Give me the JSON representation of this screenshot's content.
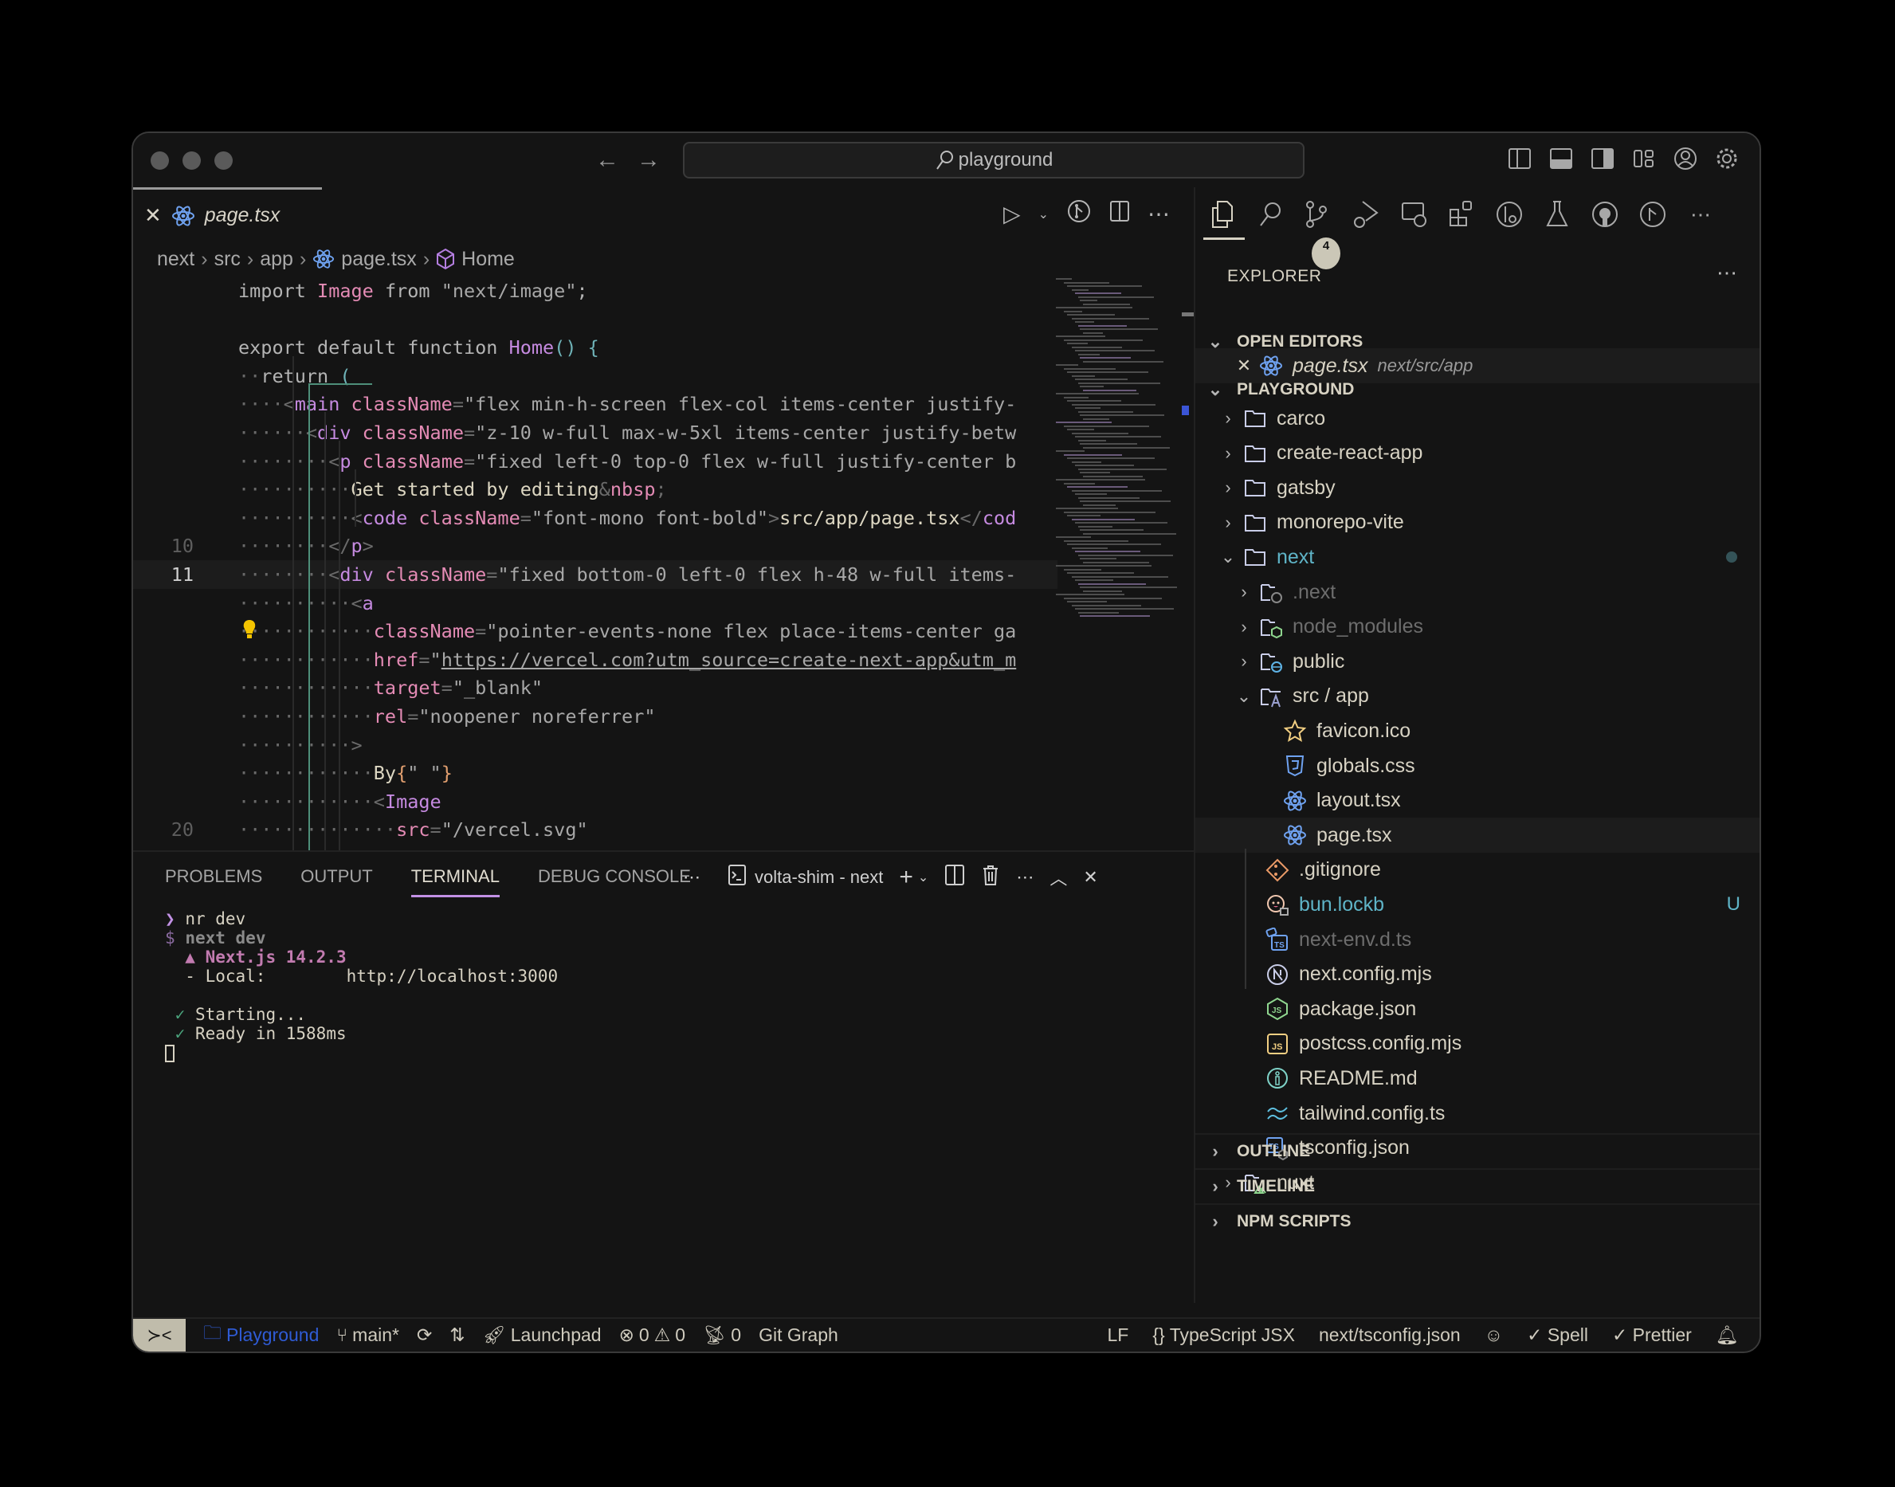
{
  "window": {
    "search_text": "playground",
    "nav_back": "←",
    "nav_forward": "→"
  },
  "editor": {
    "tab_label": "page.tsx",
    "breadcrumb": [
      "next",
      "src",
      "app",
      "page.tsx",
      "Home"
    ],
    "lines": [
      {
        "n": "",
        "html": "<span class='k'>import</span> <span class='a'>Image</span> <span class='k'>from</span> <span class='s'>\"next/image\"</span><span class='k'>;</span>"
      },
      {
        "n": "",
        "html": ""
      },
      {
        "n": "",
        "html": "<span class='k'>export default function</span> <span class='f'>Home</span><span class='p'>() {</span>"
      },
      {
        "n": "",
        "html": "<span class='dim'>··</span><span class='k'>return</span> <span class='p'>(</span>"
      },
      {
        "n": "",
        "html": "<span class='dim'>····</span><span class='dim'>&lt;</span><span class='t'>main</span> <span class='a'>className</span><span class='dim'>=</span><span class='s'>\"flex min-h-screen flex-col items-center justify-</span>"
      },
      {
        "n": "",
        "html": "<span class='dim'>······</span><span class='dim'>&lt;</span><span class='t'>div</span> <span class='a'>className</span><span class='dim'>=</span><span class='s'>\"z-10 w-full max-w-5xl items-center justify-betw</span>"
      },
      {
        "n": "",
        "html": "<span class='dim'>········</span><span class='dim'>&lt;</span><span class='t'>p</span> <span class='a'>className</span><span class='dim'>=</span><span class='s'>\"fixed left-0 top-0 flex w-full justify-center b</span>"
      },
      {
        "n": "",
        "html": "<span class='dim'>··········</span><span class='w'>Get started by editing</span><span class='dim'>&amp;</span><span class='a'>nbsp</span><span class='dim'>;</span>"
      },
      {
        "n": "",
        "html": "<span class='dim'>··········</span><span class='dim'>&lt;</span><span class='t'>code</span> <span class='a'>className</span><span class='dim'>=</span><span class='s'>\"font-mono font-bold\"</span><span class='dim'>&gt;</span><span class='w'>src/app/page.tsx</span><span class='dim'>&lt;/</span><span class='t'>cod</span>"
      },
      {
        "n": "10",
        "html": "<span class='dim'>········</span><span class='dim'>&lt;/</span><span class='t'>p</span><span class='dim'>&gt;</span>"
      },
      {
        "n": "11",
        "html": "<span class='dim'>········</span><span class='dim'>&lt;</span><span class='t'>div</span> <span class='a'>className</span><span class='dim'>=</span><span class='s'>\"fixed bottom-0 left-0 flex h-48 w-full items-</span>",
        "active": true
      },
      {
        "n": "",
        "html": "<span class='dim'>··········</span><span class='dim'>&lt;</span><span class='t'>a</span>"
      },
      {
        "n": "",
        "html": "<span class='dim'>············</span><span class='a'>className</span><span class='dim'>=</span><span class='s'>\"pointer-events-none flex place-items-center ga</span>"
      },
      {
        "n": "",
        "html": "<span class='dim'>············</span><span class='a'>href</span><span class='dim'>=</span><span class='s'>\"</span><span class='u'>https://vercel.com?utm_source=create-next-app&amp;utm_m</span>"
      },
      {
        "n": "",
        "html": "<span class='dim'>············</span><span class='a'>target</span><span class='dim'>=</span><span class='s'>\"_blank\"</span>"
      },
      {
        "n": "",
        "html": "<span class='dim'>············</span><span class='a'>rel</span><span class='dim'>=</span><span class='s'>\"noopener noreferrer\"</span>"
      },
      {
        "n": "",
        "html": "<span class='dim'>··········&gt;</span>"
      },
      {
        "n": "",
        "html": "<span class='dim'>············</span><span class='w'>By</span><span class='o'>{</span><span class='s'>\" \"</span><span class='o'>}</span>"
      },
      {
        "n": "",
        "html": "<span class='dim'>············&lt;</span><span class='t'>Image</span>"
      },
      {
        "n": "20",
        "html": "<span class='dim'>··············</span><span class='a'>src</span><span class='dim'>=</span><span class='s'>\"/vercel.svg\"</span>"
      }
    ]
  },
  "panel": {
    "tabs": [
      "PROBLEMS",
      "OUTPUT",
      "TERMINAL",
      "DEBUG CONSOLE"
    ],
    "active_tab": "TERMINAL",
    "terminal_name": "volta-shim - next",
    "terminal": {
      "cmd": "nr dev",
      "cmd2": "next dev",
      "next_version": "▲ Next.js 14.2.3",
      "local_label": "- Local:",
      "local_url": "http://localhost:3000",
      "starting": "Starting...",
      "ready": "Ready in 1588ms"
    }
  },
  "sidebar": {
    "explorer_title": "EXPLORER",
    "scm_badge": "4",
    "open_editors_title": "OPEN EDITORS",
    "open_editor": {
      "name": "page.tsx",
      "path": "next/src/app"
    },
    "workspace_title": "PLAYGROUND",
    "tree": [
      {
        "label": "carco",
        "type": "folder",
        "depth": 0,
        "expanded": false
      },
      {
        "label": "create-react-app",
        "type": "folder",
        "depth": 0,
        "expanded": false
      },
      {
        "label": "gatsby",
        "type": "folder",
        "depth": 0,
        "expanded": false
      },
      {
        "label": "monorepo-vite",
        "type": "folder",
        "depth": 0,
        "expanded": false
      },
      {
        "label": "next",
        "type": "folder",
        "depth": 0,
        "expanded": true,
        "modified": true
      },
      {
        "label": ".next",
        "type": "folder-next",
        "depth": 1,
        "expanded": false,
        "muted": true
      },
      {
        "label": "node_modules",
        "type": "folder-node",
        "depth": 1,
        "expanded": false,
        "muted": true
      },
      {
        "label": "public",
        "type": "folder-public",
        "depth": 1,
        "expanded": false
      },
      {
        "label": "src / app",
        "type": "folder-app",
        "depth": 1,
        "expanded": true
      },
      {
        "label": "favicon.ico",
        "type": "favicon",
        "depth": 2
      },
      {
        "label": "globals.css",
        "type": "css",
        "depth": 2
      },
      {
        "label": "layout.tsx",
        "type": "react",
        "depth": 2
      },
      {
        "label": "page.tsx",
        "type": "react",
        "depth": 2,
        "selected": true
      },
      {
        "label": ".gitignore",
        "type": "git",
        "depth": 1
      },
      {
        "label": "bun.lockb",
        "type": "bun",
        "depth": 1,
        "untracked": true,
        "status": "U"
      },
      {
        "label": "next-env.d.ts",
        "type": "ts-def",
        "depth": 1,
        "muted": true
      },
      {
        "label": "next.config.mjs",
        "type": "next",
        "depth": 1
      },
      {
        "label": "package.json",
        "type": "node",
        "depth": 1
      },
      {
        "label": "postcss.config.mjs",
        "type": "js",
        "depth": 1
      },
      {
        "label": "README.md",
        "type": "info",
        "depth": 1
      },
      {
        "label": "tailwind.config.ts",
        "type": "tailwind",
        "depth": 1
      },
      {
        "label": "tsconfig.json",
        "type": "tsconfig",
        "depth": 1
      },
      {
        "label": "nuxt",
        "type": "folder-nuxt",
        "depth": 0,
        "expanded": false
      }
    ],
    "collapsed_sections": [
      "OUTLINE",
      "TIMELINE",
      "NPM SCRIPTS"
    ]
  },
  "statusbar": {
    "workspace": "Playground",
    "branch": "main*",
    "launchpad": "Launchpad",
    "errors": "0",
    "warnings": "0",
    "ports": "0",
    "git_graph": "Git Graph",
    "eol": "LF",
    "language": "TypeScript JSX",
    "tsconfig": "next/tsconfig.json",
    "spell": "Spell",
    "prettier": "Prettier"
  },
  "colors": {
    "accent_purple": "#c291e5",
    "react_blue": "#6fa2f0",
    "git_teal": "#5fb4c7",
    "statusbar_blue": "#2f5bd4"
  }
}
